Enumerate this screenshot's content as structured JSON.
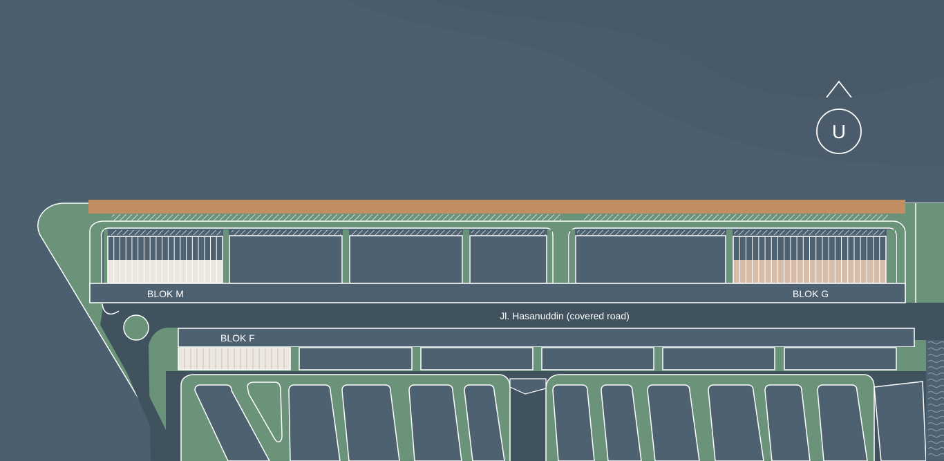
{
  "labels": {
    "blok_m": "BLOK M",
    "blok_g": "BLOK G",
    "blok_f": "BLOK F",
    "road": "Jl. Hasanuddin (covered road)"
  },
  "compass": {
    "letter": "U"
  },
  "colors": {
    "background": "#4b5f6e",
    "green_area": "#6b937a",
    "road": "#3f525d",
    "building": "#4d6171",
    "outline": "#ffffff",
    "highlight_strip": "#c08e62",
    "unit_light": "#ece7df",
    "unit_tan": "#d7bda9"
  }
}
